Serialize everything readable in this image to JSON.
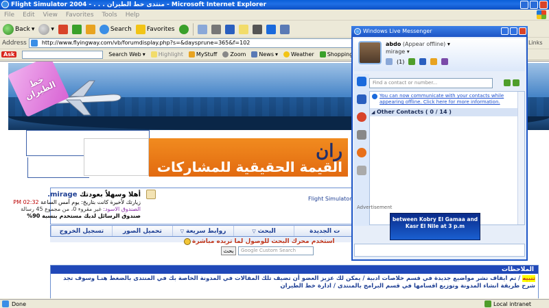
{
  "ie": {
    "title": "Flight Simulator 2004 - . . . منتدى خط الطيران - Microsoft Internet Explorer",
    "menu": [
      "File",
      "Edit",
      "View",
      "Favorites",
      "Tools",
      "Help"
    ],
    "toolbar": {
      "back": "Back",
      "search": "Search",
      "favorites": "Favorites"
    },
    "address_label": "Address",
    "address_url": "http://www.flyingway.com/vb/forumdisplay.php?s=&daysprune=365&f=102",
    "links_label": "Links",
    "status_done": "Done",
    "status_zone": "Local intranet"
  },
  "ask_bar": {
    "logo": "Ask",
    "search_web": "Search Web",
    "highlight": "Highlight",
    "mystuff": "MyStuff",
    "zoom": "Zoom",
    "news": "News",
    "weather": "Weather",
    "shopping": "Shopping"
  },
  "forum": {
    "logo_text": "خط الطيران",
    "banner_line1": "ران",
    "banner_line2": "القيمة الحقيقية للمشاركات",
    "forum_title": "Flight Simulator",
    "welcome_prefix": "أهلا وسهلاً بعودتك ",
    "welcome_user": "mirage.",
    "last_visit_text": "زيارتك لأخيرة كانت بتاريخ: يوم أمس الساعة ",
    "last_visit_time": "02:32 PM",
    "inbox_label": "الصندوق الاسود: ",
    "inbox_text": "غير مقروء 0، من مجموع 45 رسالة",
    "usage_text": "صندوق الرسائل لديك مستخدم بنسبة 90%",
    "nav": [
      "ت الجديدة",
      "البحث",
      "روابط سريعة",
      "تحميل الصور",
      "تسجيل الخروج"
    ],
    "search_hint": "استخدم محرك البحث للوصول لما تريده مباشرة",
    "search_button": "بحث",
    "search_placeholder": "Google Custom Search",
    "notes_header": "الملاحظات",
    "notes_highlight": "تنبيه",
    "notes_body": " / تم ايقاف نشر مواضيع جديدة في قسم خلاصات ادبية / يمكن لك عزيز العضو أن تضيف تلك المقالات في المدونة الخاصة بك في المنتدى بالضغط هنـا وسوف تجد شرح طريقة انشاء المدونة وتوزيع اقسامها في قسم البرامج بالمنتدى  /  ادارة خط الطيران"
  },
  "messenger": {
    "title": "Windows Live Messenger",
    "name": "abdo",
    "status": "(Appear offline)",
    "personal_message": "mirage",
    "mail_count": "(1)",
    "find_placeholder": "Find a contact or number...",
    "info_text": "You can now communicate with your contacts while appearing offline. Click here for more information.",
    "group_label": "Other Contacts ( 0 / 14 )",
    "ad_label": "Advertisement",
    "ad_text": "between Kobry El Gamaa and Kasr El Nile at 3 p.m"
  }
}
